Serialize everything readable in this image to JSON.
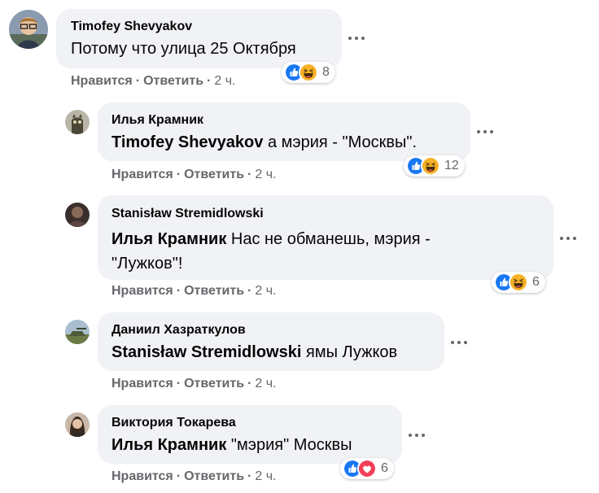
{
  "comments": [
    {
      "author": "Timofey Shevyakov",
      "mention": "",
      "text": "Потому что улица 25 Октября",
      "actions": {
        "like": "Нравится",
        "reply": "Ответить",
        "time": "2 ч."
      },
      "reactions": {
        "icons": [
          "like",
          "haha"
        ],
        "count": "8"
      }
    },
    {
      "author": "Илья Крамник",
      "mention": "Timofey Shevyakov",
      "text": "а мэрия - \"Москвы\".",
      "actions": {
        "like": "Нравится",
        "reply": "Ответить",
        "time": "2 ч."
      },
      "reactions": {
        "icons": [
          "like",
          "haha"
        ],
        "count": "12"
      }
    },
    {
      "author": "Stanisław Stremidlowski",
      "mention": "Илья Крамник",
      "text": "Нас не обманешь, мэрия -",
      "text2": "\"Лужков\"!",
      "actions": {
        "like": "Нравится",
        "reply": "Ответить",
        "time": "2 ч."
      },
      "reactions": {
        "icons": [
          "like",
          "haha"
        ],
        "count": "6"
      }
    },
    {
      "author": "Даниил Хазраткулов",
      "mention": "Stanisław Stremidlowski",
      "text": "ямы Лужков",
      "actions": {
        "like": "Нравится",
        "reply": "Ответить",
        "time": "2 ч."
      }
    },
    {
      "author": "Виктория Токарева",
      "mention": "Илья Крамник",
      "text": "\"мэрия\" Москвы",
      "actions": {
        "like": "Нравится",
        "reply": "Ответить",
        "time": "2 ч."
      },
      "reactions": {
        "icons": [
          "like",
          "love"
        ],
        "count": "6"
      }
    }
  ],
  "colors": {
    "bubble": "#f0f2f5",
    "meta": "#65676b",
    "like": "#1877f2",
    "haha": "#f7b125",
    "love": "#f33e58"
  }
}
